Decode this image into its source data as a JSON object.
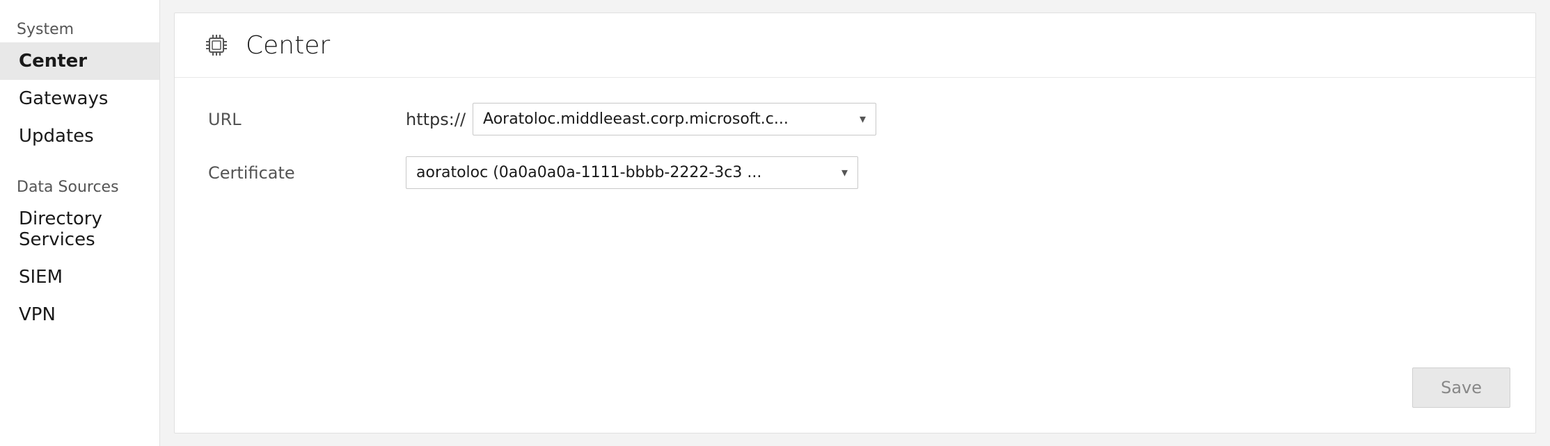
{
  "sidebar": {
    "system_label": "System",
    "data_sources_label": "Data Sources",
    "items": [
      {
        "id": "center",
        "label": "Center",
        "active": true
      },
      {
        "id": "gateways",
        "label": "Gateways",
        "active": false
      },
      {
        "id": "updates",
        "label": "Updates",
        "active": false
      },
      {
        "id": "directory-services",
        "label": "Directory Services",
        "active": false
      },
      {
        "id": "siem",
        "label": "SIEM",
        "active": false
      },
      {
        "id": "vpn",
        "label": "VPN",
        "active": false
      }
    ]
  },
  "header": {
    "title": "Center",
    "chip_icon": "chip"
  },
  "form": {
    "url_label": "URL",
    "url_prefix": "https://",
    "url_value": "Aoratoloc.middleeast.corp.microsoft.c...",
    "certificate_label": "Certificate",
    "certificate_value": "aoratoloc (0a0a0a0a-1111-bbbb-2222-3c3 ..."
  },
  "buttons": {
    "save_label": "Save"
  }
}
